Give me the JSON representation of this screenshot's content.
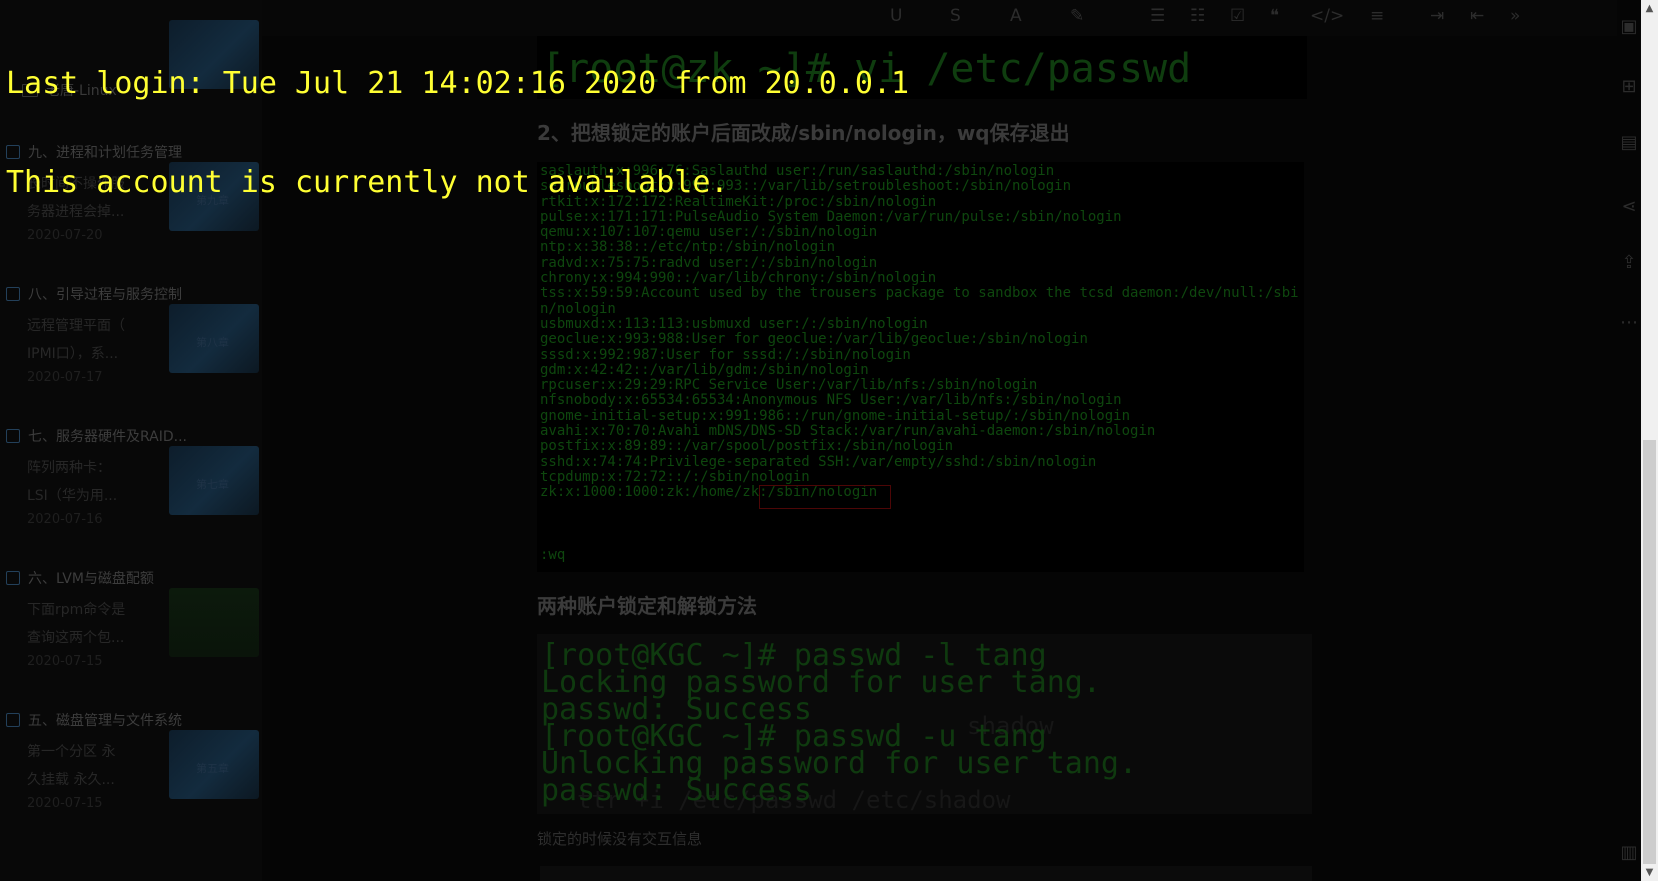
{
  "terminal": {
    "lines": [
      "Last login: Tue Jul 21 14:02:16 2020 from 20.0.0.1",
      "This account is currently not available."
    ]
  },
  "sidebar": {
    "folder_label": "老唐-Linux",
    "notes": [
      {
        "title": "九、进程和计划任务管理",
        "snippet": [
          "长时间不操作服",
          "务器进程会掉..."
        ],
        "date": "2020-07-20",
        "thumb": "第九章"
      },
      {
        "title": "八、引导过程与服务控制",
        "snippet": [
          "远程管理平面（",
          "IPMI口），系..."
        ],
        "date": "2020-07-17",
        "thumb": "第八章"
      },
      {
        "title": "七、服务器硬件及RAID...",
        "snippet": [
          "阵列两种卡：",
          "LSI（华为用..."
        ],
        "date": "2020-07-16",
        "thumb": "第七章"
      },
      {
        "title": "六、LVM与磁盘配额",
        "snippet": [
          "下面rpm命令是",
          "查询这两个包..."
        ],
        "date": "2020-07-15",
        "thumb": ""
      },
      {
        "title": "五、磁盘管理与文件系统",
        "snippet": [
          "第一个分区 永",
          "久挂载 永久..."
        ],
        "date": "2020-07-15",
        "thumb": "第五章"
      }
    ]
  },
  "editor": {
    "term1_cmd": "[root@zk ~]# vi /etc/passwd",
    "step2_heading": "2、把想锁定的账户后面改成/sbin/nologin，wq保存退出",
    "passwd_lines": [
      "saslauth:x:996:76:Saslauthd user:/run/saslauthd:/sbin/nologin",
      "setroubleshoot:x:995:993::/var/lib/setroubleshoot:/sbin/nologin",
      "rtkit:x:172:172:RealtimeKit:/proc:/sbin/nologin",
      "pulse:x:171:171:PulseAudio System Daemon:/var/run/pulse:/sbin/nologin",
      "qemu:x:107:107:qemu user:/:/sbin/nologin",
      "ntp:x:38:38::/etc/ntp:/sbin/nologin",
      "radvd:x:75:75:radvd user:/:/sbin/nologin",
      "chrony:x:994:990::/var/lib/chrony:/sbin/nologin",
      "tss:x:59:59:Account used by the trousers package to sandbox the tcsd daemon:/dev/null:/sbi",
      "n/nologin",
      "usbmuxd:x:113:113:usbmuxd user:/:/sbin/nologin",
      "geoclue:x:993:988:User for geoclue:/var/lib/geoclue:/sbin/nologin",
      "sssd:x:992:987:User for sssd:/:/sbin/nologin",
      "gdm:x:42:42::/var/lib/gdm:/sbin/nologin",
      "rpcuser:x:29:29:RPC Service User:/var/lib/nfs:/sbin/nologin",
      "nfsnobody:x:65534:65534:Anonymous NFS User:/var/lib/nfs:/sbin/nologin",
      "gnome-initial-setup:x:991:986::/run/gnome-initial-setup/:/sbin/nologin",
      "avahi:x:70:70:Avahi mDNS/DNS-SD Stack:/var/run/avahi-daemon:/sbin/nologin",
      "postfix:x:89:89::/var/spool/postfix:/sbin/nologin",
      "sshd:x:74:74:Privilege-separated SSH:/var/empty/sshd:/sbin/nologin",
      "tcpdump:x:72:72::/:/sbin/nologin",
      "zk:x:1000:1000:zk:/home/zk:/sbin/nologin"
    ],
    "passwd_wq": ":wq",
    "lock_heading": "两种账户锁定和解锁方法",
    "term2_lines": [
      "[root@KGC ~]# passwd -l tang",
      "Locking password for user tang.",
      "passwd: Success",
      "[root@KGC ~]# passwd -u tang",
      "Unlocking password for user tang.",
      "passwd: Success"
    ],
    "ghost_shadow_1": "shadow",
    "ghost_shadow_2": "ttr +i /etc/passwd /etc/shadow",
    "note_text": "锁定的时候没有交互信息"
  }
}
